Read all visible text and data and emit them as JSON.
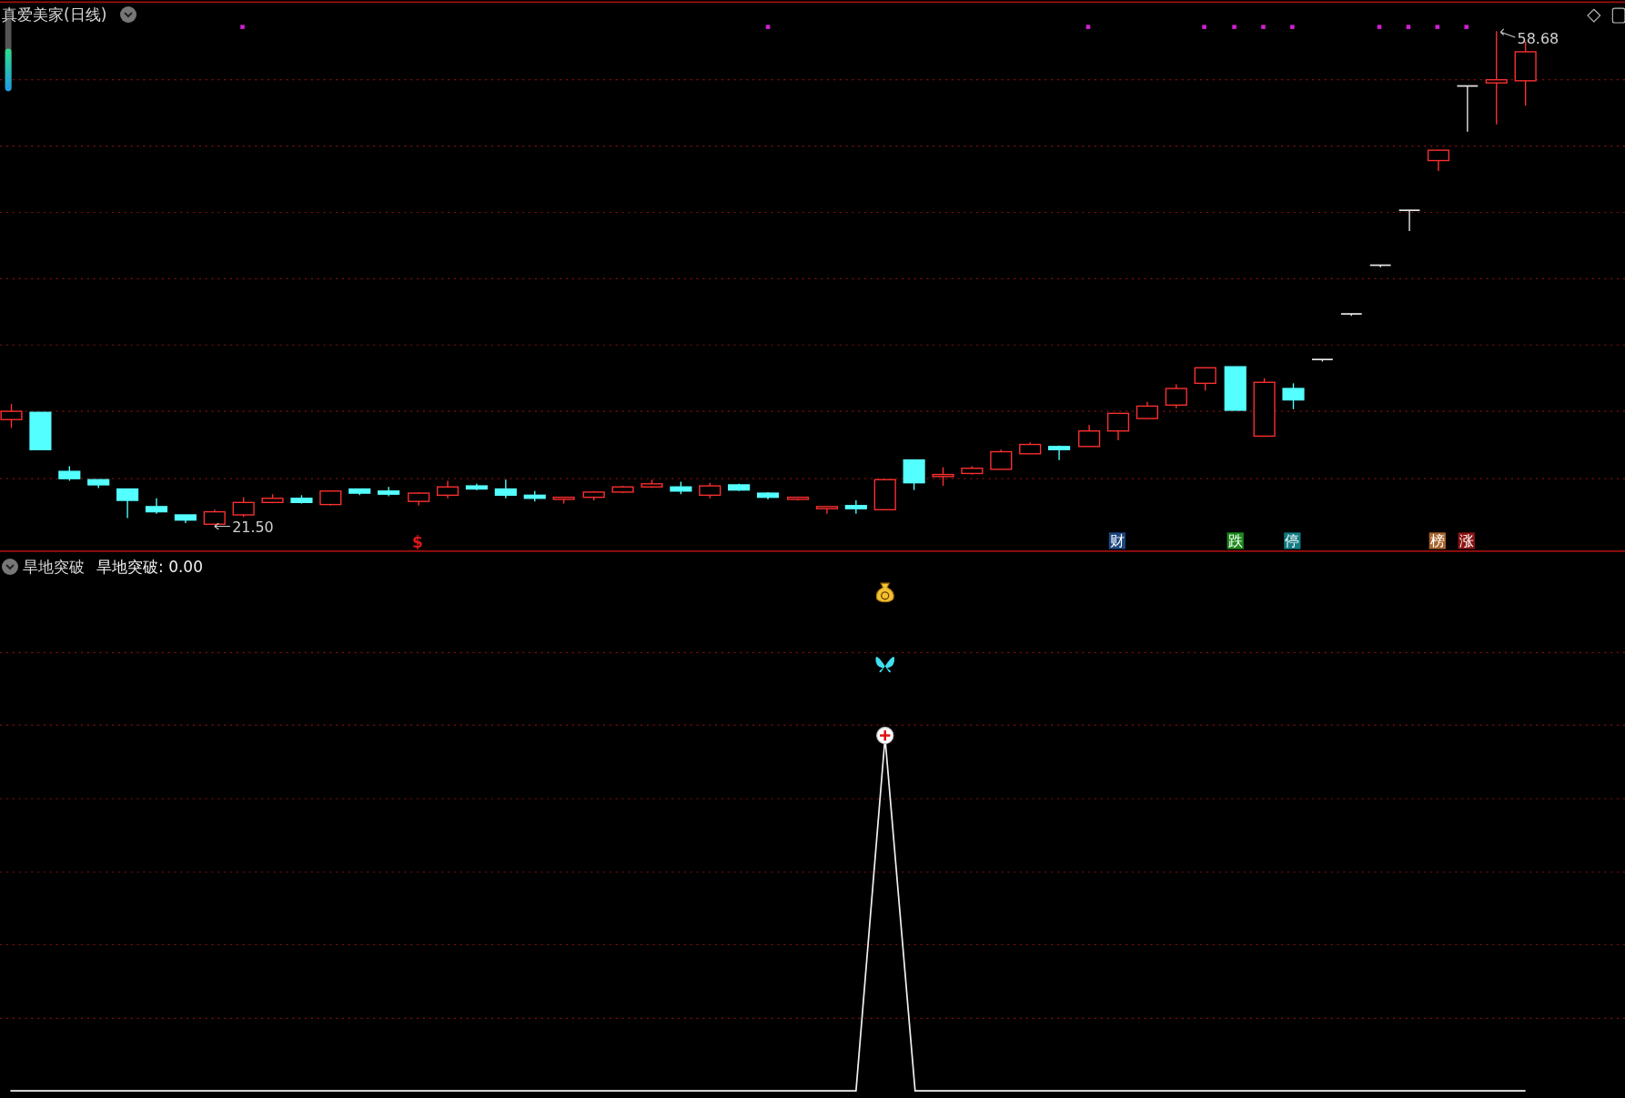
{
  "price_panel": {
    "title": "真爱美家(日线)",
    "high_label": "58.68",
    "low_label": "21.50",
    "badges": [
      {
        "kind": "mark",
        "text": "$",
        "color": "#e01818"
      },
      {
        "kind": "tag",
        "text": "财",
        "color": "#1c467e"
      },
      {
        "kind": "tag",
        "text": "跌",
        "color": "#1d8a1d"
      },
      {
        "kind": "tag",
        "text": "停",
        "color": "#137b82"
      },
      {
        "kind": "tag",
        "text": "榜",
        "color": "#a8652c"
      },
      {
        "kind": "tag",
        "text": "涨",
        "color": "#8c1414"
      }
    ]
  },
  "indicator_panel": {
    "name": "旱地突破",
    "reading": "旱地突破: 0.00"
  }
}
